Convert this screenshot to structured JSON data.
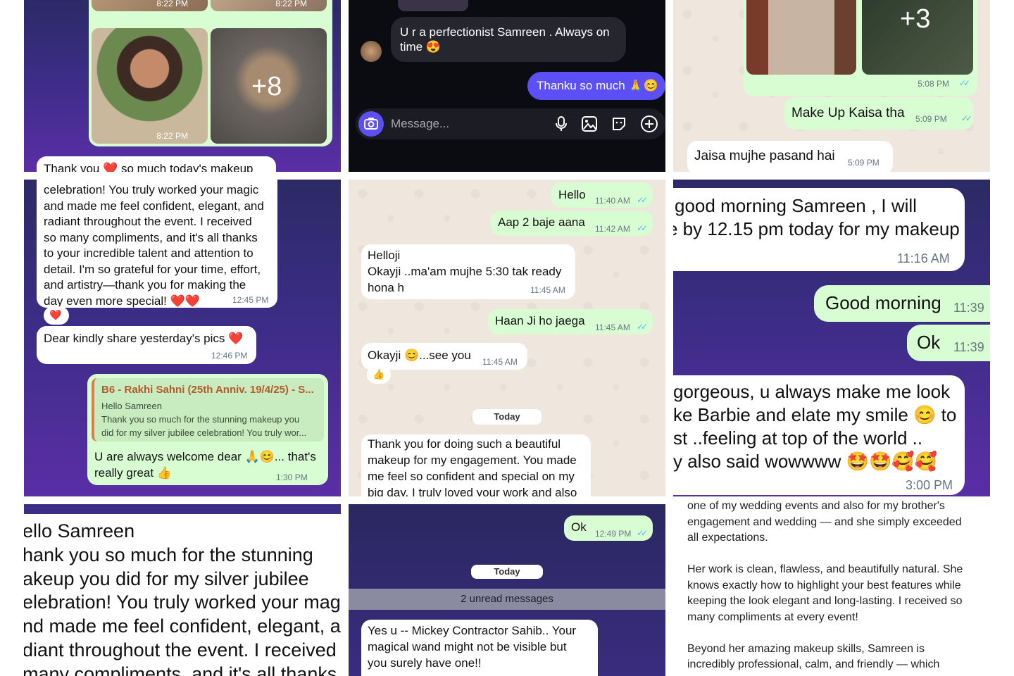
{
  "tile1": {
    "photo_times": [
      "8:22 PM",
      "8:22 PM",
      "8:22 PM"
    ],
    "more_count": "+8",
    "msg_partial": "Thank you ❤️ so much today's makeup"
  },
  "tile2": {
    "incoming": [
      "U r a perfectionist Samreen . Always on",
      "time 😍"
    ],
    "outgoing": "Thanku so much 🙏😊",
    "composer_placeholder": "Message..."
  },
  "tile3": {
    "more_count": "+3",
    "t1": "5:08 PM",
    "out_msg": "Make Up Kaisa tha",
    "out_time": "5:09 PM",
    "in_msg": "Jaisa mujhe pasand hai",
    "in_time": "5:09 PM"
  },
  "tile4": {
    "lines": [
      "celebration! You truly worked your magic",
      "and made me feel confident, elegant, and",
      "radiant throughout the event. I received",
      "so many compliments, and it's all thanks",
      "to your incredible talent and attention to",
      "detail. I'm so grateful for your time, effort,",
      "and artistry—thank you for making the",
      "day even more special! ❤️❤️"
    ],
    "time1": "12:45 PM",
    "reaction": "❤️",
    "msg2": "Dear kindly share yesterday's pics ❤️",
    "time2": "12:46 PM",
    "reply_title": "B6 - Rakhi Sahni (25th Anniv. 19/4/25) - S...",
    "reply_lines": [
      "Hello Samreen",
      "Thank you so much for the stunning makeup you",
      "did for my silver jubilee celebration! You truly wor..."
    ],
    "reply_msg": [
      "U are always welcome dear 🙏😊... that's",
      "really great 👍"
    ],
    "reply_time": "1:30 PM"
  },
  "tile5": {
    "out1": "Hello",
    "out1_time": "11:40 AM",
    "out2": "Aap 2 baje aana",
    "out2_time": "11:42 AM",
    "in1": [
      "Helloji",
      "Okayji ..ma'am mujhe 5:30 tak ready",
      "hona h"
    ],
    "in1_time": "11:45 AM",
    "out3": "Haan Ji ho jaega",
    "out3_time": "11:45 AM",
    "in2": "Okayji 😊...see you",
    "in2_time": "11:45 AM",
    "in2_reaction": "👍",
    "day_label": "Today",
    "in3": [
      "Thank you for doing such a beautiful",
      "makeup for my engagement. You made",
      "me feel so confident and special on my",
      "big day. I truly loved your work and also"
    ]
  },
  "tile6": {
    "in1": [
      "good morning Samreen , I will",
      "e by 12.15 pm today for my makeup"
    ],
    "in1_time": "11:16 AM",
    "out1": "Good morning",
    "out1_time": "11:39",
    "out2": "Ok",
    "out2_time": "11:39",
    "in2": [
      "gorgeous, u always make me look",
      "ke Barbie and elate my smile 😊 to",
      "st ..feeling at top of the world ..",
      "y also said wowwww 🤩🤩🥰🥰"
    ],
    "in2_time": "3:00 PM"
  },
  "tile7": {
    "lines": [
      "ello Samreen",
      "hank you so much for the stunning",
      "akeup you did for my silver jubilee",
      "elebration! You truly worked your magic",
      "nd made me feel confident, elegant, an",
      "diant throughout the event. I received",
      "many compliments, and it's all thanks"
    ]
  },
  "tile8": {
    "out1": "Ok",
    "out1_time": "12:49 PM",
    "day_label": "Today",
    "unread": "2 unread messages",
    "in1": [
      "Yes u -- Mickey Contractor Sahib.. Your",
      "magical wand might not be visible but",
      "you surely have one!!"
    ]
  },
  "tile9": {
    "lines": [
      "one of my wedding events and also for my brother's",
      "engagement and wedding — and she simply exceeded",
      "all expectations.",
      "",
      "Her work is clean, flawless, and beautifully natural. She",
      "knows exactly how to highlight your best features while",
      "keeping the look elegant and long-lasting. I received so",
      "many compliments at every event!",
      "",
      "Beyond her amazing makeup skills, Samreen is",
      "incredibly professional, calm, and friendly — which"
    ]
  },
  "colors": {
    "wa_green": "#d9fdd3",
    "ig_purple": "#5b4ff5",
    "ticks": "#53bdeb"
  }
}
